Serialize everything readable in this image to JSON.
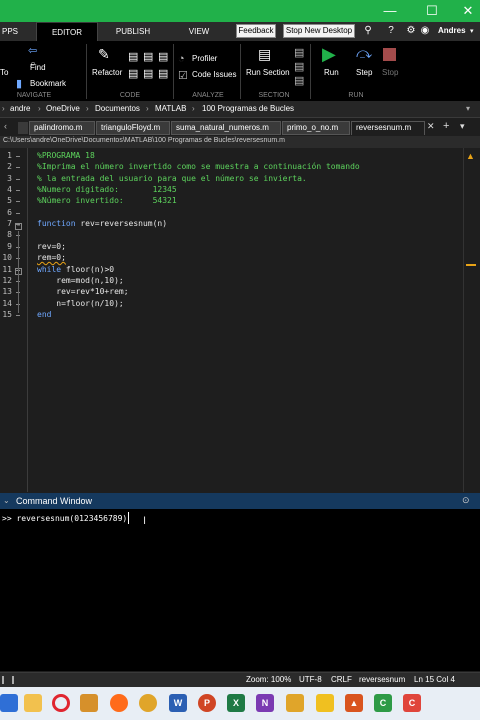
{
  "colors": {
    "title_bar": "#21b14a",
    "ribbon": "#000000",
    "editor_bg": "#1e1e1e",
    "comment": "#5dd35d",
    "keyword": "#6fa8ff",
    "cmd_header": "#15395e",
    "taskbar": "#e8eef5"
  },
  "ribbon_tabs": [
    "PPS",
    "EDITOR",
    "PUBLISH",
    "VIEW"
  ],
  "toolbar_buttons": {
    "feedback": "Feedback",
    "stop_desktop": "Stop New Desktop",
    "user": "Andres"
  },
  "ribbon": {
    "navigate": {
      "to": "To",
      "find": "Find",
      "bookmark": "Bookmark",
      "group": "NAVIGATE"
    },
    "code": {
      "refactor": "Refactor",
      "group": "CODE"
    },
    "analyze": {
      "profiler": "Profiler",
      "code_issues": "Code Issues",
      "group": "ANALYZE"
    },
    "section": {
      "run_section": "Run Section",
      "group": "SECTION"
    },
    "run": {
      "run": "Run",
      "step": "Step",
      "stop": "Stop",
      "group": "RUN"
    }
  },
  "breadcrumb": [
    "andre",
    "OneDrive",
    "Documentos",
    "MATLAB",
    "100 Programas de Bucles"
  ],
  "file_tabs": [
    "palindromo.m",
    "trianguloFloyd.m",
    "suma_natural_numeros.m",
    "primo_o_no.m",
    "reversesnum.m"
  ],
  "path": "C:\\Users\\andre\\OneDrive\\Documentos\\MATLAB\\100 Programas de Bucles\\reversesnum.m",
  "code_lines": [
    {
      "n": "1",
      "text": "%PROGRAMA 18",
      "kind": "comment"
    },
    {
      "n": "2",
      "text": "%Imprima el número invertido como se muestra a continuación tomando",
      "kind": "comment"
    },
    {
      "n": "3",
      "text": "% la entrada del usuario para que el número se invierta.",
      "kind": "comment"
    },
    {
      "n": "4",
      "text": "%Numero digitado:       12345",
      "kind": "comment"
    },
    {
      "n": "5",
      "text": "%Número invertido:      54321",
      "kind": "comment"
    },
    {
      "n": "6",
      "text": "",
      "kind": "text"
    },
    {
      "n": "7",
      "kw": "function",
      "text": " rev=reversesnum(n)",
      "kind": "mixed"
    },
    {
      "n": "8",
      "text": "",
      "kind": "text"
    },
    {
      "n": "9",
      "text": "rev=0;",
      "kind": "text"
    },
    {
      "n": "10",
      "text": "rem=0;",
      "kind": "text"
    },
    {
      "n": "11",
      "kw": "while",
      "text": " floor(n)>0",
      "kind": "mixed"
    },
    {
      "n": "12",
      "text": "    rem=mod(n,10);",
      "kind": "text"
    },
    {
      "n": "13",
      "text": "    rev=rev*10+rem;",
      "kind": "text"
    },
    {
      "n": "14",
      "text": "    n=floor(n/10);",
      "kind": "text"
    },
    {
      "n": "15",
      "kw": "end",
      "text": "",
      "kind": "mixed"
    }
  ],
  "command_window": {
    "title": "Command Window",
    "prompt": ">> reversesnum(0123456789)"
  },
  "status": {
    "zoom": "Zoom: 100%",
    "encoding": "UTF-8",
    "eol": "CRLF",
    "file": "reversesnum",
    "position": "Ln 15 Col 4"
  },
  "taskbar_icons": [
    "start",
    "file-explorer",
    "folder",
    "opera",
    "firefox",
    "chrome",
    "word",
    "powerpoint",
    "excel",
    "onenote",
    "app",
    "matlab",
    "camtasia",
    "camtasia-recorder"
  ]
}
